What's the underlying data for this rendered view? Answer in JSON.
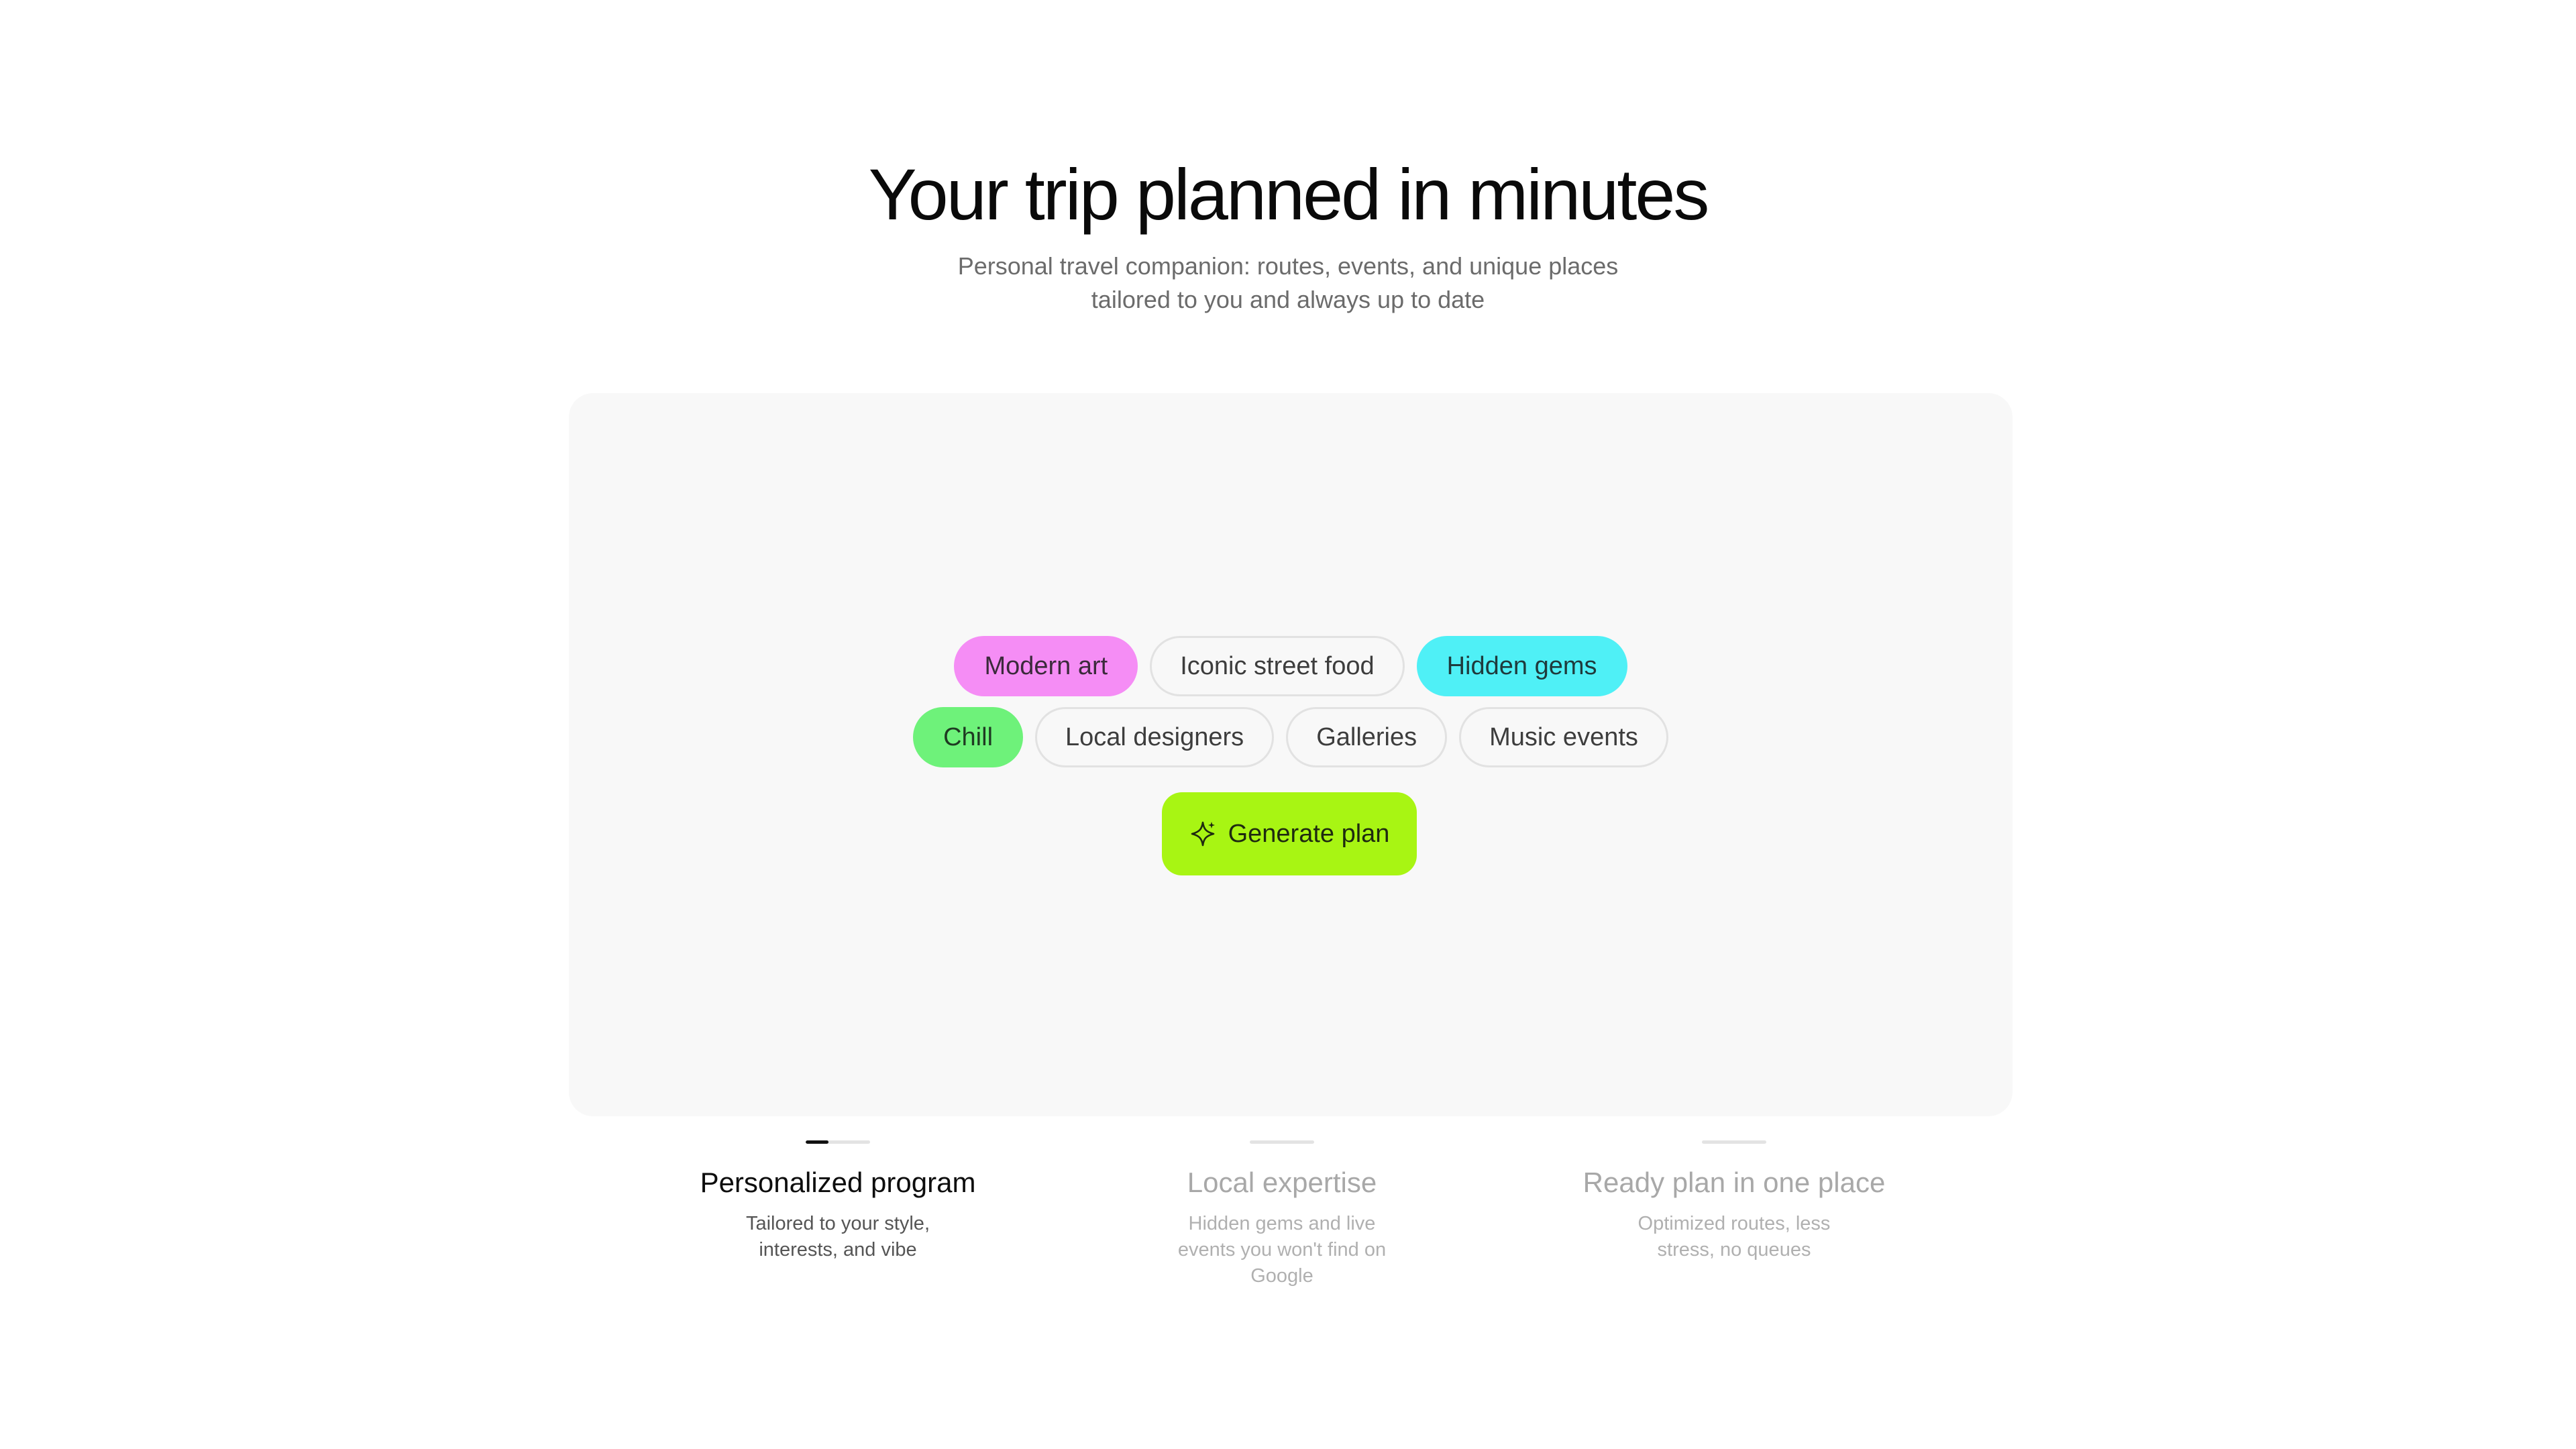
{
  "hero": {
    "title": "Your trip planned in minutes",
    "subtitle": "Personal travel companion: routes, events, and unique places tailored to you and always up to date"
  },
  "tags": {
    "row1": [
      {
        "label": "Modern art",
        "state": "selected",
        "color": "#f58df5"
      },
      {
        "label": "Iconic street food",
        "state": "unselected",
        "color": "#f8f8f8"
      },
      {
        "label": "Hidden gems",
        "state": "selected",
        "color": "#4ff0f6"
      }
    ],
    "row2": [
      {
        "label": "Chill",
        "state": "selected",
        "color": "#6ef27a"
      },
      {
        "label": "Local designers",
        "state": "unselected",
        "color": "#f8f8f8"
      },
      {
        "label": "Galleries",
        "state": "unselected",
        "color": "#f8f8f8"
      },
      {
        "label": "Music events",
        "state": "unselected",
        "color": "#f8f8f8"
      }
    ]
  },
  "generate": {
    "label": "Generate plan",
    "icon": "sparkle-icon",
    "color": "#a8f513"
  },
  "features": [
    {
      "title": "Personalized program",
      "description": "Tailored to your style, interests, and vibe",
      "active": true,
      "progress": 0.35
    },
    {
      "title": "Local expertise",
      "description": "Hidden gems and live events you won't find on Google",
      "active": false,
      "progress": 0
    },
    {
      "title": "Ready plan in one place",
      "description": "Optimized routes, less stress, no queues",
      "active": false,
      "progress": 0
    }
  ]
}
